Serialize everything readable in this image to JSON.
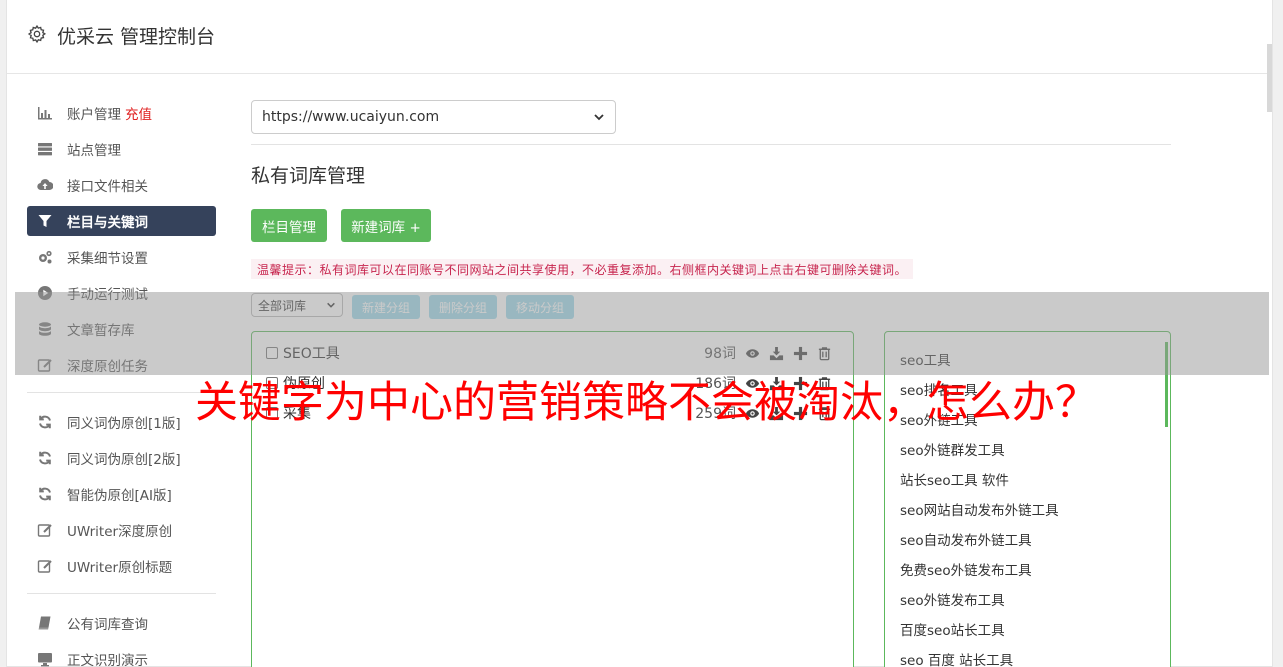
{
  "app": {
    "title": "优采云 管理控制台"
  },
  "sidebar": {
    "items": [
      {
        "label": "账户管理",
        "badge": "充值",
        "icon": "bar-chart-icon"
      },
      {
        "label": "站点管理",
        "icon": "server-list-icon"
      },
      {
        "label": "接口文件相关",
        "icon": "cloud-upload-icon"
      },
      {
        "label": "栏目与关键词",
        "icon": "filter-icon",
        "active": true
      },
      {
        "label": "采集细节设置",
        "icon": "cogs-icon"
      },
      {
        "label": "手动运行测试",
        "icon": "play-circle-icon"
      },
      {
        "label": "文章暂存库",
        "icon": "database-icon"
      },
      {
        "label": "深度原创任务",
        "icon": "edit-icon"
      },
      {
        "label": "同义词伪原创[1版]",
        "icon": "refresh-icon"
      },
      {
        "label": "同义词伪原创[2版]",
        "icon": "refresh-icon"
      },
      {
        "label": "智能伪原创[AI版]",
        "icon": "refresh-icon"
      },
      {
        "label": "UWriter深度原创",
        "icon": "edit-icon"
      },
      {
        "label": "UWriter原创标题",
        "icon": "edit-icon"
      },
      {
        "label": "公有词库查询",
        "icon": "book-icon"
      },
      {
        "label": "正文识别演示",
        "icon": "monitor-icon"
      }
    ]
  },
  "main": {
    "site_select": "https://www.ucaiyun.com",
    "section_title": "私有词库管理",
    "btn_columns": "栏目管理",
    "btn_new_lib": "新建词库 +",
    "tip": "温馨提示：私有词库可以在同账号不同网站之间共享使用，不必重复添加。右侧框内关键词上点击右键可删除关键词。",
    "group_select": "全部词库",
    "btn_new_group": "新建分组",
    "btn_del_group": "删除分组",
    "btn_move_group": "移动分组",
    "libraries": [
      {
        "name": "SEO工具",
        "count": "98词"
      },
      {
        "name": "伪原创",
        "count": "186词"
      },
      {
        "name": "采集",
        "count": "259词"
      }
    ],
    "keywords": [
      "seo工具",
      "seo排名工具",
      "seo外链工具",
      "seo外链群发工具",
      "站长seo工具 软件",
      "seo网站自动发布外链工具",
      "seo自动发布外链工具",
      "免费seo外链发布工具",
      "seo外链发布工具",
      "百度seo站长工具",
      "seo 百度 站长工具"
    ]
  },
  "overlay": {
    "headline": "关键字为中心的营销策略不会被淘汰，怎么办？"
  },
  "colors": {
    "accent_green": "#5cb85c",
    "active_nav": "#35425b",
    "headline_red": "#ff0000",
    "tip_text": "#c7254e"
  }
}
